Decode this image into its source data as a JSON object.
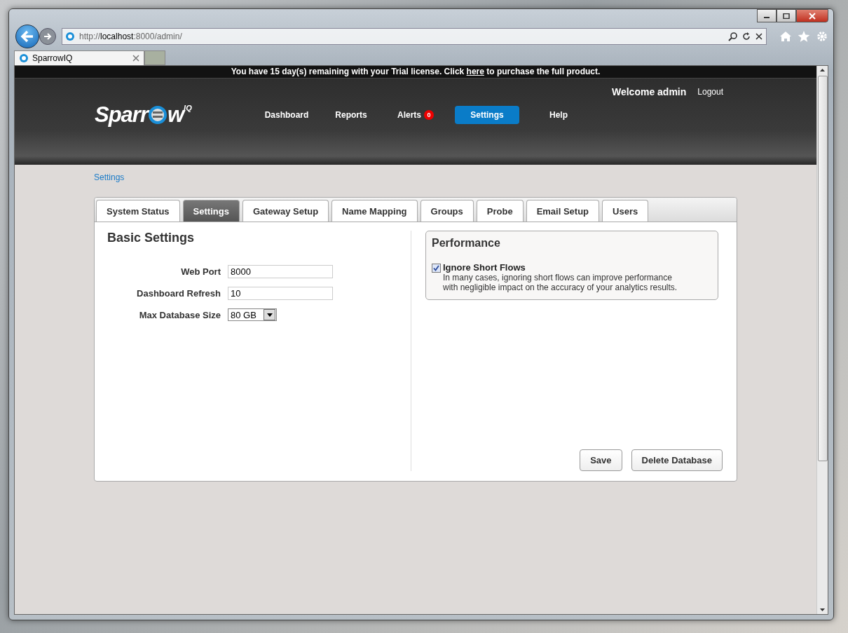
{
  "browser": {
    "address_prefix": "http://",
    "address_host": "localhost",
    "address_rest": ":8000/admin/",
    "tab_title": "SparrowIQ"
  },
  "banner": {
    "before": "You have 15 day(s) remaining with your Trial license. Click ",
    "link": "here",
    "after": " to purchase the full product."
  },
  "header": {
    "welcome": "Welcome admin",
    "logout": "Logout",
    "logo_start": "Sparr",
    "logo_end": "w",
    "logo_sup": "IQ",
    "nav": [
      {
        "label": "Dashboard",
        "selected": false
      },
      {
        "label": "Reports",
        "selected": false
      },
      {
        "label": "Alerts",
        "selected": false,
        "badge": "0"
      },
      {
        "label": "Settings",
        "selected": true
      },
      {
        "label": "Help",
        "selected": false
      }
    ]
  },
  "breadcrumb": "Settings",
  "tabs": [
    {
      "label": "System Status",
      "selected": false
    },
    {
      "label": "Settings",
      "selected": true
    },
    {
      "label": "Gateway Setup",
      "selected": false
    },
    {
      "label": "Name Mapping",
      "selected": false
    },
    {
      "label": "Groups",
      "selected": false
    },
    {
      "label": "Probe",
      "selected": false
    },
    {
      "label": "Email Setup",
      "selected": false
    },
    {
      "label": "Users",
      "selected": false
    }
  ],
  "basic": {
    "title": "Basic Settings",
    "fields": [
      {
        "kind": "text",
        "label": "Web Port",
        "value": "8000"
      },
      {
        "kind": "text",
        "label": "Dashboard Refresh",
        "value": "10"
      },
      {
        "kind": "select",
        "label": "Max Database Size",
        "value": "80 GB"
      }
    ]
  },
  "performance": {
    "title": "Performance",
    "option": {
      "label": "Ignore Short Flows",
      "checked": true,
      "description": "In many cases, ignoring short flows can improve performance with negligible impact on the accuracy of your analytics results."
    }
  },
  "buttons": [
    "Save",
    "Delete Database"
  ]
}
